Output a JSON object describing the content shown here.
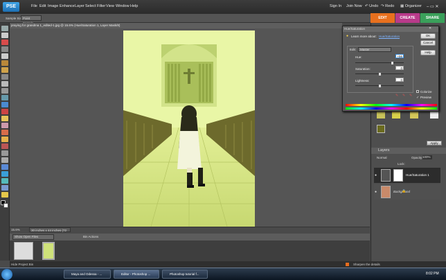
{
  "app": {
    "logo": "PSE",
    "menu": [
      "File",
      "Edit",
      "Image",
      "Enhance",
      "Layer",
      "Select",
      "Filter",
      "View",
      "Window",
      "Help"
    ],
    "signin": "Sign In",
    "join": "Join Now",
    "undo": "Undo",
    "redo": "Redo",
    "organizer": "Organizer",
    "modes": [
      {
        "label": "EDIT",
        "color": "#e8701e"
      },
      {
        "label": "CREATE",
        "color": "#b83a8a"
      },
      {
        "label": "SHARE",
        "color": "#3aa05a"
      }
    ]
  },
  "options": {
    "sample_size_label": "Sample Size:",
    "sample_size_value": "Point Sample"
  },
  "document": {
    "title": "praying for grandma 1_edited-1.jpg @ 15.6% (Hue/Saturation 1, Layer Mask/8)",
    "zoom": "15.6%",
    "size": "30 inches x 44 inches (72 ppi)"
  },
  "bin": {
    "dropdown": "Show Open Files",
    "actions": "Bin Actions",
    "hide": "Hide Project Bin"
  },
  "hint": "Sharpen the details",
  "dialog": {
    "title": "Hue/Saturation",
    "learn": "Learn more about:",
    "learn_link": "Hue/Saturation",
    "ok": "OK",
    "cancel": "Cancel",
    "help": "Help",
    "edit_label": "Edit:",
    "edit_value": "Master",
    "hue_label": "Hue:",
    "hue_value": "+56",
    "saturation_label": "Saturation:",
    "saturation_value": "0",
    "lightness_label": "Lightness:",
    "lightness_value": "0",
    "colorize": "Colorize",
    "preview": "Preview",
    "colorize_checked": false,
    "preview_checked": true
  },
  "panel": {
    "apply": "Apply",
    "layers_title": "Layers",
    "blend": "Normal",
    "opacity_label": "Opacity:",
    "opacity_value": "100%",
    "lock_label": "Lock:",
    "layers": [
      {
        "name": "Hue/Saturation 1",
        "selected": true
      },
      {
        "name": "Background",
        "selected": false
      }
    ]
  },
  "taskbar": {
    "items": [
      "Maya and Odessa - ...",
      "Editor - Photoshop ...",
      "Photoshop tutorial f..."
    ],
    "clock": "8:02 PM"
  }
}
